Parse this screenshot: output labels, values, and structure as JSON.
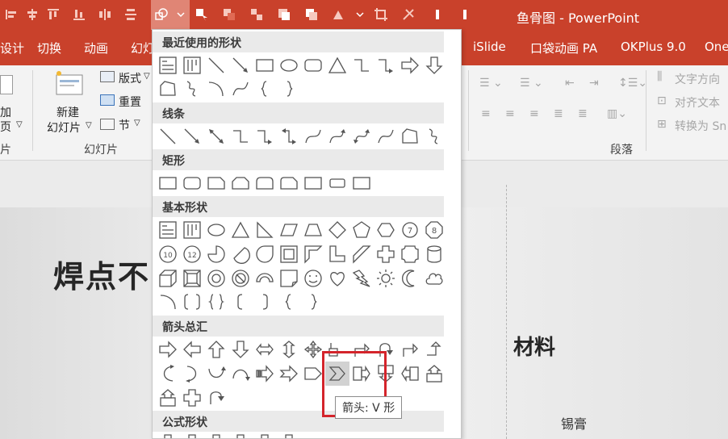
{
  "window": {
    "title": "鱼骨图 - PowerPoint"
  },
  "tabs": [
    {
      "label": "设计"
    },
    {
      "label": "切换"
    },
    {
      "label": "动画"
    },
    {
      "label": "幻灯"
    },
    {
      "label": "iSlide"
    },
    {
      "label": "口袋动画 PA"
    },
    {
      "label": "OKPlus 9.0"
    },
    {
      "label": "One"
    }
  ],
  "ribbon": {
    "slides": {
      "add_label_1": "加",
      "add_label_2": "页",
      "new_slide_1": "新建",
      "new_slide_2": "幻灯片",
      "layout": "版式",
      "reset": "重置",
      "section": "节",
      "group_left": "片",
      "group_label": "幻灯片"
    },
    "paragraph": {
      "text_direction": "文字方向",
      "align_text": "对齐文本",
      "convert_smartart": "转换为 Sn",
      "group_label": "段落"
    }
  },
  "shapes_panel": {
    "sections": [
      {
        "title": "最近使用的形状"
      },
      {
        "title": "线条"
      },
      {
        "title": "矩形"
      },
      {
        "title": "基本形状"
      },
      {
        "title": "箭头总汇"
      },
      {
        "title": "公式形状"
      }
    ],
    "tooltip": "箭头: V 形"
  },
  "slide": {
    "title": "焊点不",
    "heading": "材料",
    "small_text": "锡膏"
  },
  "colors": {
    "titlebar": "#c9412b",
    "highlight": "#d4242b"
  }
}
